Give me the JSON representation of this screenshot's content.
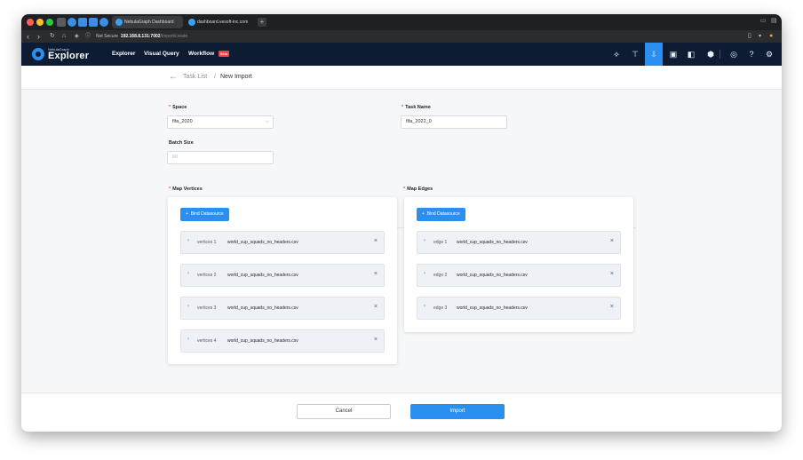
{
  "browser": {
    "tabs": [
      {
        "title": "NebulaGraph Dashboard"
      },
      {
        "title": "dashboard.vesoft-inc.com"
      }
    ],
    "address": {
      "security": "Not Secure",
      "host": "192.168.8.131:7002",
      "path": "/import/create"
    }
  },
  "app": {
    "brand_sub": "NebulaGraph",
    "brand": "Explorer",
    "nav": [
      {
        "label": "Explorer"
      },
      {
        "label": "Visual Query"
      },
      {
        "label": "Workflow"
      }
    ],
    "beta_label": "Beta",
    "toolbar_icons": [
      "schema-icon",
      "console-icon",
      "import-icon",
      "sketch-icon",
      "analysis-icon",
      "database-icon",
      "language-icon",
      "help-icon",
      "settings-icon"
    ]
  },
  "breadcrumb": {
    "parent": "Task List",
    "separator": "/",
    "current": "New Import"
  },
  "form": {
    "space_label": "Space",
    "space_value": "fifa_2020",
    "task_name_label": "Task Name",
    "task_name_value": "fifa_2022_0",
    "batch_size_label": "Batch Size",
    "batch_size_placeholder": "60"
  },
  "vertices": {
    "label": "Map Vertices",
    "bind_label": "Bind Datasource",
    "items": [
      {
        "name": "vertices 1",
        "file": "world_cup_squads_no_headers.csv"
      },
      {
        "name": "vertices 2",
        "file": "world_cup_squads_no_headers.csv"
      },
      {
        "name": "vertices 3",
        "file": "world_cup_squads_no_headers.csv"
      },
      {
        "name": "vertices 4",
        "file": "world_cup_squads_no_headers.csv"
      }
    ]
  },
  "edges": {
    "label": "Map Edges",
    "bind_label": "Bind Datasource",
    "items": [
      {
        "name": "edge 1",
        "file": "world_cup_squads_no_headers.csv"
      },
      {
        "name": "edge 2",
        "file": "world_cup_squads_no_headers.csv"
      },
      {
        "name": "edge 3",
        "file": "world_cup_squads_no_headers.csv"
      }
    ]
  },
  "footer": {
    "cancel_label": "Cancel",
    "import_label": "Import"
  },
  "colors": {
    "accent": "#2b8ff0",
    "nav_bg": "#0d1b33",
    "required": "#e5484d"
  }
}
